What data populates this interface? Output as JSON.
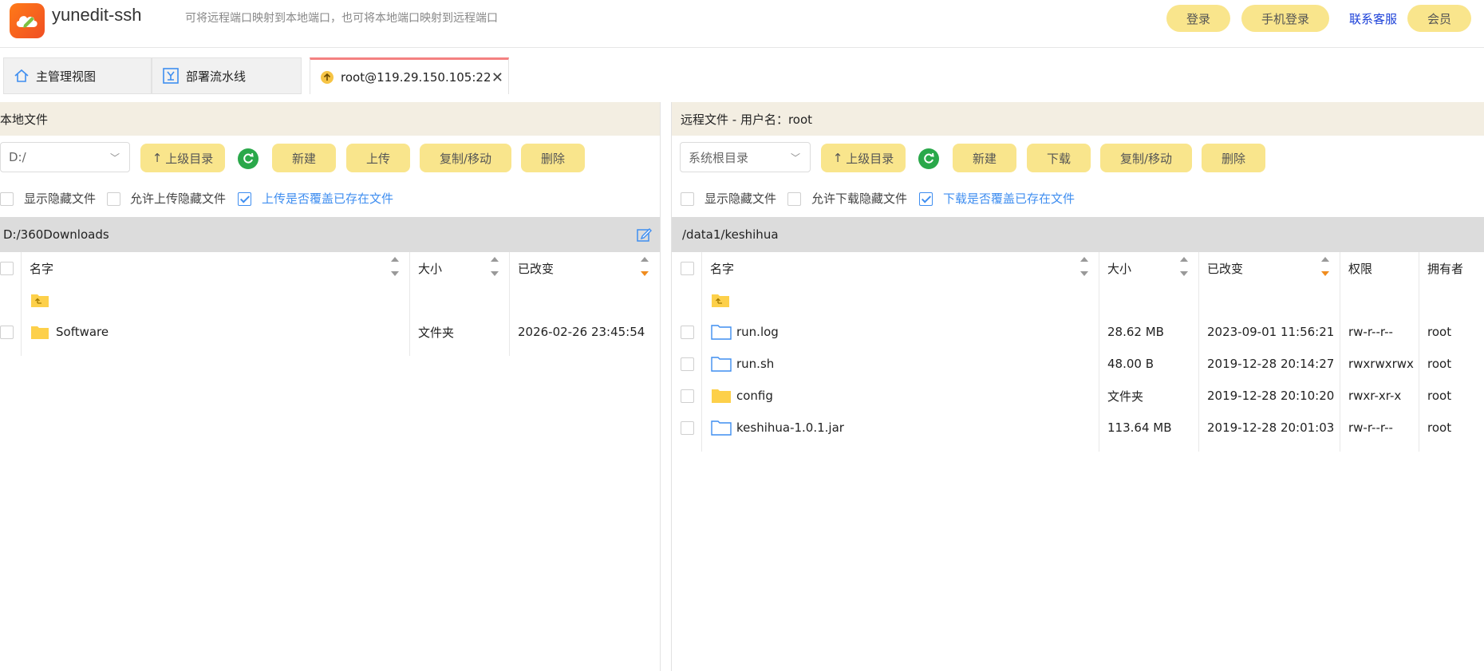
{
  "app": {
    "name": "yunedit-ssh",
    "subtitle": "可将远程端口映射到本地端口，也可将本地端口映射到远程端口",
    "brand_color": "#f26522"
  },
  "top_buttons": {
    "login": "登录",
    "phone_login": "手机登录",
    "support": "联系客服",
    "member": "会员"
  },
  "tabs": [
    {
      "label": "主管理视图",
      "icon": "home-icon"
    },
    {
      "label": "部署流水线",
      "icon": "pipeline-icon"
    },
    {
      "label": "root@119.29.150.105:22",
      "icon": "upload-circle-icon",
      "active": true
    }
  ],
  "local": {
    "title": "本地文件",
    "drive": "D:/",
    "buttons": {
      "up": "上级目录",
      "new": "新建",
      "upload": "上传",
      "copy_move": "复制/移动",
      "delete": "删除"
    },
    "options": {
      "show_hidden": "显示隐藏文件",
      "allow_upload_hidden": "允许上传隐藏文件",
      "overwrite": "上传是否覆盖已存在文件"
    },
    "path": "D:/360Downloads",
    "columns": {
      "name": "名字",
      "size": "大小",
      "modified": "已改变"
    },
    "rows": [
      {
        "name": "",
        "size": "",
        "modified": "",
        "type": "parent"
      },
      {
        "name": "Software",
        "size": "文件夹",
        "modified": "2026-02-26 23:45:54",
        "type": "folder"
      }
    ]
  },
  "remote": {
    "title": "远程文件 - 用户名：root",
    "root": "系统根目录",
    "buttons": {
      "up": "上级目录",
      "new": "新建",
      "download": "下载",
      "copy_move": "复制/移动",
      "delete": "删除"
    },
    "options": {
      "show_hidden": "显示隐藏文件",
      "allow_download_hidden": "允许下载隐藏文件",
      "overwrite": "下载是否覆盖已存在文件"
    },
    "path": "/data1/keshihua",
    "columns": {
      "name": "名字",
      "size": "大小",
      "modified": "已改变",
      "perm": "权限",
      "owner": "拥有者"
    },
    "rows": [
      {
        "name": "",
        "size": "",
        "modified": "",
        "perm": "",
        "owner": "",
        "type": "parent"
      },
      {
        "name": "run.log",
        "size": "28.62 MB",
        "modified": "2023-09-01 11:56:21",
        "perm": "rw-r--r--",
        "owner": "root",
        "type": "file"
      },
      {
        "name": "run.sh",
        "size": "48.00 B",
        "modified": "2019-12-28 20:14:27",
        "perm": "rwxrwxrwx",
        "owner": "root",
        "type": "file"
      },
      {
        "name": "config",
        "size": "文件夹",
        "modified": "2019-12-28 20:10:20",
        "perm": "rwxr-xr-x",
        "owner": "root",
        "type": "folder"
      },
      {
        "name": "keshihua-1.0.1.jar",
        "size": "113.64 MB",
        "modified": "2019-12-28 20:01:03",
        "perm": "rw-r--r--",
        "owner": "root",
        "type": "file"
      }
    ]
  }
}
